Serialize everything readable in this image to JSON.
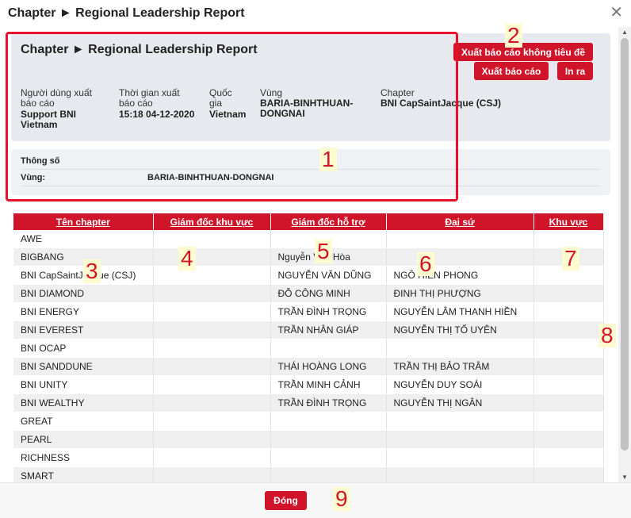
{
  "dialog": {
    "title": "Chapter ► Regional Leadership Report",
    "close_glyph": "✕"
  },
  "report": {
    "title": "Chapter ► Regional Leadership Report",
    "buttons": {
      "export_no_title": "Xuất báo cáo không tiêu đề",
      "export": "Xuất báo cáo",
      "print": "In ra"
    },
    "info": [
      {
        "label": "Người dùng xuất báo cáo",
        "value": "Support BNI Vietnam"
      },
      {
        "label": "Thời gian xuất báo cáo",
        "value": "15:18 04-12-2020"
      },
      {
        "label": "Quốc gia",
        "value": "Vietnam"
      },
      {
        "label": "Vùng",
        "value": "BARIA-BINHTHUAN-DONGNAI"
      },
      {
        "label": "Chapter",
        "value": "BNI CapSaintJacque (CSJ)"
      }
    ]
  },
  "params": {
    "heading": "Thông số",
    "region_label": "Vùng:",
    "region_value": "BARIA-BINHTHUAN-DONGNAI"
  },
  "table": {
    "headers": [
      "Tên chapter",
      "Giám đốc khu vực",
      "Giám đốc hỗ trợ",
      "Đại sứ",
      "Khu vực"
    ],
    "rows": [
      [
        "AWE",
        "",
        "",
        "",
        ""
      ],
      [
        "BIGBANG",
        "",
        "Nguyễn Văn Hòa",
        "",
        ""
      ],
      [
        "BNI CapSaintJacque (CSJ)",
        "",
        "NGUYỄN VĂN DŨNG",
        "NGÔ HIỀN PHONG",
        ""
      ],
      [
        "BNI DIAMOND",
        "",
        "ĐỖ CÔNG MINH",
        "ĐINH THỊ PHƯỢNG",
        ""
      ],
      [
        "BNI ENERGY",
        "",
        "TRẦN ĐÌNH TRỌNG",
        "NGUYỄN LÂM THANH HIỀN",
        ""
      ],
      [
        "BNI EVEREST",
        "",
        "TRẦN NHÂN GIÁP",
        "NGUYỄN THỊ TỐ UYÊN",
        ""
      ],
      [
        "BNI OCAP",
        "",
        "",
        "",
        ""
      ],
      [
        "BNI SANDDUNE",
        "",
        "THÁI HOÀNG LONG",
        "TRẦN THỊ BẢO TRÂM",
        ""
      ],
      [
        "BNI UNITY",
        "",
        "TRẦN MINH CẢNH",
        "NGUYỄN DUY SOÁI",
        ""
      ],
      [
        "BNI WEALTHY",
        "",
        "TRẦN ĐÌNH TRỌNG",
        "NGUYỄN THỊ NGÂN",
        ""
      ],
      [
        "GREAT",
        "",
        "",
        "",
        ""
      ],
      [
        "PEARL",
        "",
        "",
        "",
        ""
      ],
      [
        "RICHNESS",
        "",
        "",
        "",
        ""
      ],
      [
        "SMART",
        "",
        "",
        "",
        ""
      ]
    ]
  },
  "footer": {
    "close_label": "Đóng"
  },
  "callouts": [
    "1",
    "2",
    "3",
    "4",
    "5",
    "6",
    "7",
    "8",
    "9"
  ],
  "colors": {
    "accent": "#d0152b",
    "callout_text": "#d0152b",
    "callout_bg": "#fffbd0",
    "frame": "#e8112d"
  }
}
